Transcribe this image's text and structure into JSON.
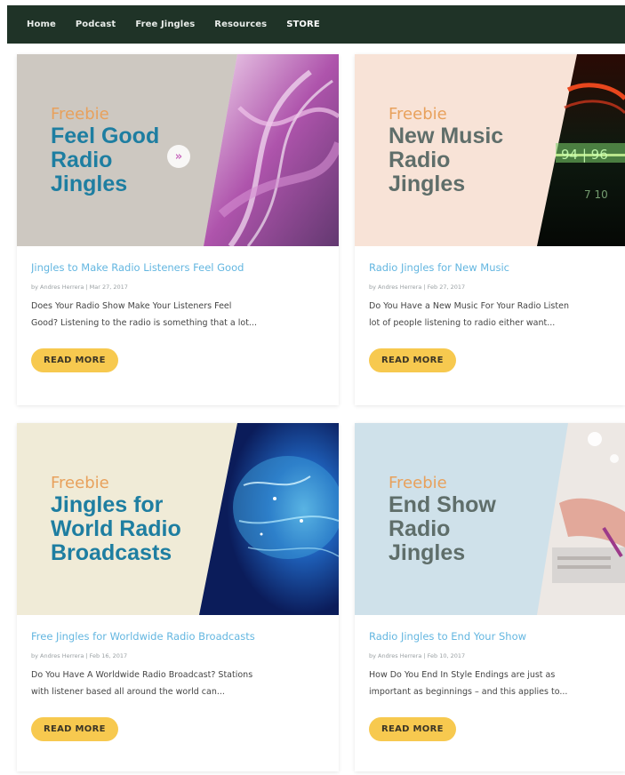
{
  "nav": {
    "items": [
      "Home",
      "Podcast",
      "Free Jingles",
      "Resources"
    ],
    "store_label": "STORE"
  },
  "colors": {
    "nav_bg": "#1f3327",
    "freebie": "#e8a15c",
    "headline_blue": "#1e7ea1",
    "headline_grey": "#5f6e6a",
    "title_link": "#63b6e0",
    "button": "#f7c94f"
  },
  "play_icon": "»",
  "cards": [
    {
      "freebie": "Freebie",
      "headline": "Feel Good\nRadio\nJingles",
      "title": "Jingles to Make Radio Listeners Feel Good",
      "meta": "by Andres Herrera | Mar 27, 2017",
      "excerpt_1": "Does Your Radio Show Make Your Listeners Feel",
      "excerpt_2": "Good? Listening to the radio is something that a lot...",
      "button": "READ MORE",
      "image_icon": "purple-light-wave-art"
    },
    {
      "freebie": "Freebie",
      "headline": "New Music\nRadio\nJingles",
      "title": "Radio Jingles for New Music",
      "meta": "by Andres Herrera | Feb 27, 2017",
      "excerpt_1": "Do You Have a New Music For Your Radio Listen",
      "excerpt_2": "lot of people listening to radio either want...",
      "button": "READ MORE",
      "image_icon": "radio-dial-art",
      "dial_text_1": "94 | 96",
      "dial_text_2": "7 10"
    },
    {
      "freebie": "Freebie",
      "headline": "Jingles for\nWorld Radio\nBroadcasts",
      "title": "Free Jingles for Worldwide Radio Broadcasts",
      "meta": "by Andres Herrera | Feb 16, 2017",
      "excerpt_1": "Do You Have A Worldwide Radio Broadcast? Stations",
      "excerpt_2": "with listener based all around the world can...",
      "button": "READ MORE",
      "image_icon": "globe-network-art"
    },
    {
      "freebie": "Freebie",
      "headline": "End Show\nRadio\nJingles",
      "title": "Radio Jingles to End Your Show",
      "meta": "by Andres Herrera | Feb 10, 2017",
      "excerpt_1": "How Do You End In Style Endings are just as",
      "excerpt_2": "important as beginnings – and this applies to...",
      "button": "READ MORE",
      "image_icon": "hand-on-mixer-art"
    }
  ]
}
